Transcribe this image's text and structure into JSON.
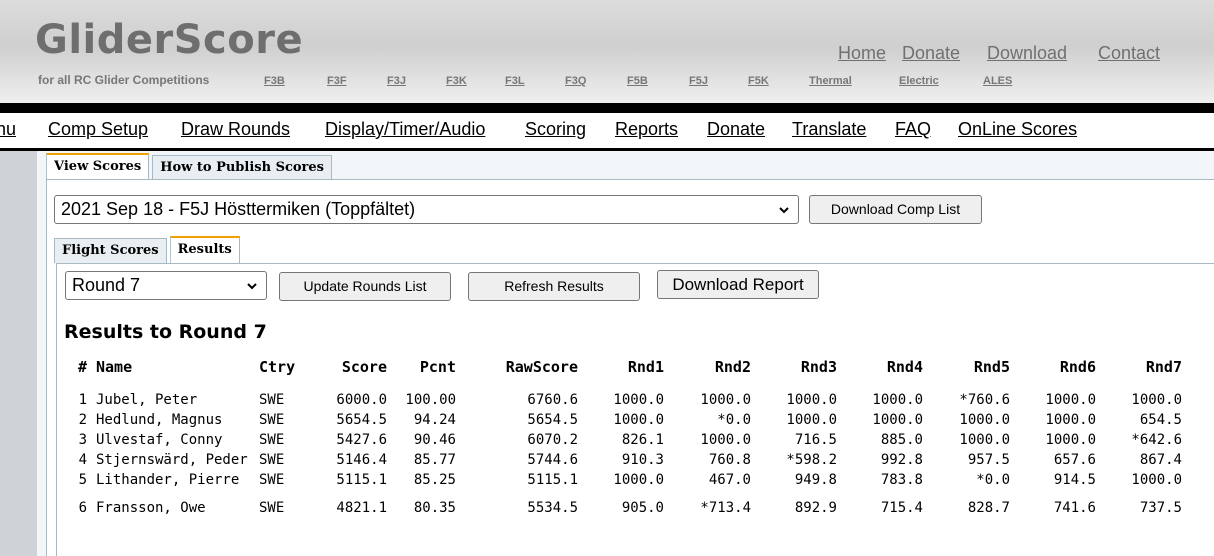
{
  "brand": {
    "logo": "GliderScore",
    "tagline": "for all RC Glider Competitions",
    "disciplines": [
      "F3B",
      "F3F",
      "F3J",
      "F3K",
      "F3L",
      "F3Q",
      "F5B",
      "F5J",
      "F5K",
      "Thermal",
      "Electric",
      "ALES"
    ]
  },
  "top_links": [
    "Home",
    "Donate",
    "Download",
    "Contact"
  ],
  "nav": {
    "partial": "nu",
    "items": [
      "Comp Setup",
      "Draw Rounds",
      "Display/Timer/Audio",
      "Scoring",
      "Reports",
      "Donate",
      "Translate",
      "FAQ",
      "OnLine Scores"
    ]
  },
  "outer_tabs": [
    "View Scores",
    "How to Publish Scores"
  ],
  "comp_select": {
    "value": "2021 Sep 18 - F5J Hösttermiken (Toppfältet)"
  },
  "download_comp_list": "Download Comp List",
  "inner_tabs": [
    "Flight Scores",
    "Results"
  ],
  "round_select": {
    "value": "Round 7"
  },
  "buttons": {
    "update_rounds": "Update Rounds List",
    "refresh": "Refresh Results",
    "download_report": "Download Report"
  },
  "results_title": "Results to Round 7",
  "table": {
    "headers": [
      "#",
      "Name",
      "Ctry",
      "Score",
      "Pcnt",
      "RawScore",
      "Rnd1",
      "Rnd2",
      "Rnd3",
      "Rnd4",
      "Rnd5",
      "Rnd6",
      "Rnd7"
    ],
    "rows": [
      [
        "1",
        "Jubel, Peter",
        "SWE",
        "6000.0",
        "100.00",
        "6760.6",
        "1000.0",
        "1000.0",
        "1000.0",
        "1000.0",
        "*760.6",
        "1000.0",
        "1000.0"
      ],
      [
        "2",
        "Hedlund, Magnus",
        "SWE",
        "5654.5",
        "94.24",
        "5654.5",
        "1000.0",
        "*0.0",
        "1000.0",
        "1000.0",
        "1000.0",
        "1000.0",
        "654.5"
      ],
      [
        "3",
        "Ulvestaf, Conny",
        "SWE",
        "5427.6",
        "90.46",
        "6070.2",
        "826.1",
        "1000.0",
        "716.5",
        "885.0",
        "1000.0",
        "1000.0",
        "*642.6"
      ],
      [
        "4",
        "Stjernswärd, Peder",
        "SWE",
        "5146.4",
        "85.77",
        "5744.6",
        "910.3",
        "760.8",
        "*598.2",
        "992.8",
        "957.5",
        "657.6",
        "867.4"
      ],
      [
        "5",
        "Lithander, Pierre",
        "SWE",
        "5115.1",
        "85.25",
        "5115.1",
        "1000.0",
        "467.0",
        "949.8",
        "783.8",
        "*0.0",
        "914.5",
        "1000.0"
      ],
      [
        "6",
        "Fransson, Owe",
        "SWE",
        "4821.1",
        "80.35",
        "5534.5",
        "905.0",
        "*713.4",
        "892.9",
        "715.4",
        "828.7",
        "741.6",
        "737.5"
      ]
    ]
  }
}
